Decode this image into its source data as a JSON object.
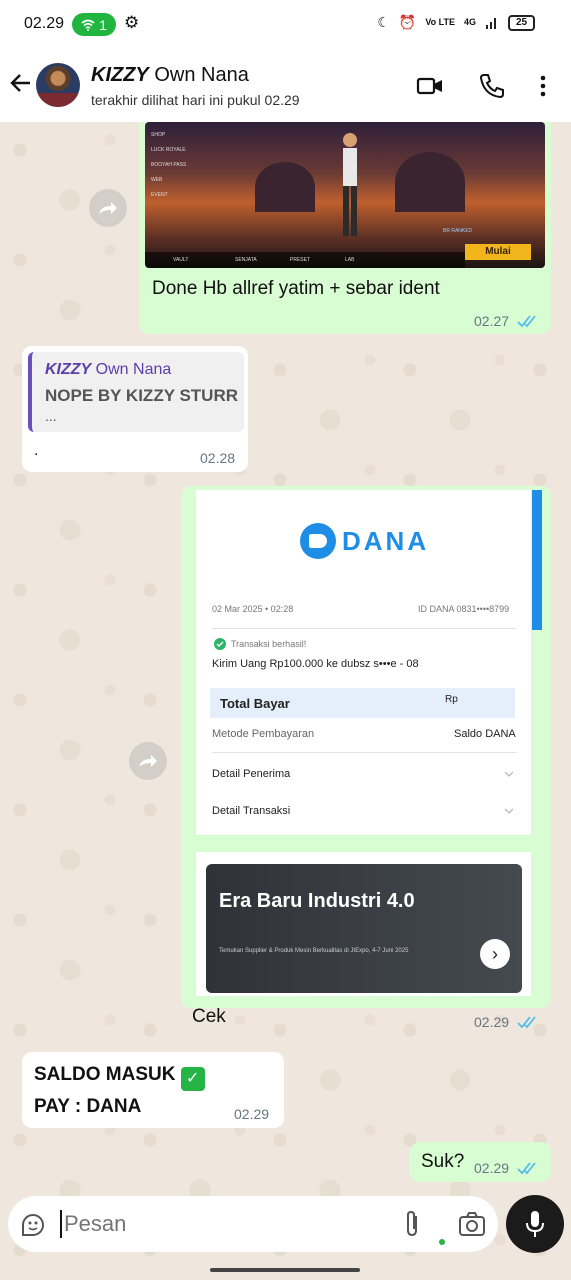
{
  "status_bar": {
    "time": "02.29",
    "notification_count": "1",
    "network": "4G",
    "network_sub": "Vo LTE",
    "battery": "25"
  },
  "header": {
    "contact_name_bold": "KIZZY",
    "contact_name_rest": " Own Nana",
    "last_seen": "terakhir dilihat hari ini pukul 02.29"
  },
  "messages": [
    {
      "id": "m1",
      "direction": "outgoing",
      "forwarded": true,
      "image": {
        "game_labels": [
          "SHOP",
          "LUCK ROYALE",
          "BOOYAH PASS",
          "WEB",
          "EVENT"
        ],
        "badge": "BR RANKED",
        "start_button": "Mulai",
        "bottom_tabs": [
          "VAULT",
          "SENJATA",
          "PRESET",
          "LAB"
        ]
      },
      "text": "Done  Hb allref yatim + sebar ident",
      "time": "02.27",
      "read": true
    },
    {
      "id": "m2",
      "direction": "incoming",
      "quote": {
        "author_bold": "KIZZY",
        "author_rest": " Own Nana",
        "text": "NOPE BY KIZZY STURR",
        "ellipsis": "..."
      },
      "text": ".",
      "time": "02.28"
    },
    {
      "id": "m3",
      "direction": "outgoing",
      "forwarded": true,
      "receipt": {
        "brand": "DANA",
        "date": "02 Mar 2025 • 02:28",
        "dana_id": "ID DANA 0831••••8799",
        "status": "Transaksi berhasil!",
        "detail": "Kirim Uang Rp100.000 ke dubsz s•••e - 08",
        "total_label": "Total Bayar",
        "total_value": "Rp",
        "method_label": "Metode Pembayaran",
        "method_value": "Saldo DANA",
        "recipient_label": "Detail Penerima",
        "transaction_label": "Detail Transaksi"
      },
      "ad": {
        "title": "Era Baru Industri 4.0",
        "subtitle": "Temukan Supplier & Produk Mesin Berkualitas di JIExpo, 4-7 Juni 2025"
      },
      "text": "Cek",
      "time": "02.29",
      "read": true
    },
    {
      "id": "m4",
      "direction": "incoming",
      "line1": "SALDO MASUK",
      "line1_icon": "✅",
      "line2": "PAY : DANA",
      "time": "02.29"
    },
    {
      "id": "m5",
      "direction": "outgoing",
      "text": "Suk?",
      "time": "02.29",
      "read": true
    }
  ],
  "input": {
    "placeholder": "Pesan"
  },
  "colors": {
    "outgoing_bubble": "#d9fdd3",
    "incoming_bubble": "#ffffff",
    "read_ticks": "#53bdeb",
    "quote_author": "#5b3fa8",
    "dana_blue": "#1e8de6"
  }
}
